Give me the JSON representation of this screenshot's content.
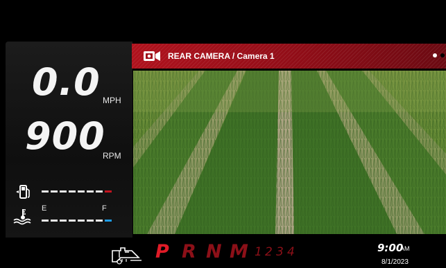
{
  "speed": {
    "value": "0.0",
    "unit": "MPH"
  },
  "rpm": {
    "value": "900",
    "unit": "RPM"
  },
  "fuel": {
    "icon": "fuel-pump-icon",
    "level": 0.88
  },
  "temperature": {
    "icon": "coolant-temperature-icon",
    "empty_label": "E",
    "full_label": "F",
    "level": 0.88
  },
  "camera": {
    "icon": "camera-icon",
    "title": "REAR CAMERA / Camera 1",
    "page_count": 2,
    "active_page": 1
  },
  "transmission": {
    "icon": "transmission-warning-icon",
    "gears": [
      "P",
      "R",
      "N",
      "M",
      "1",
      "2",
      "3",
      "4"
    ],
    "selected": "P"
  },
  "clock": {
    "time": "9:00",
    "ampm": "AM",
    "date": "8/1/2023"
  },
  "colors": {
    "accent": "#c4141f",
    "inactive_gear": "#8c1018",
    "cool": "#1e9de6"
  }
}
